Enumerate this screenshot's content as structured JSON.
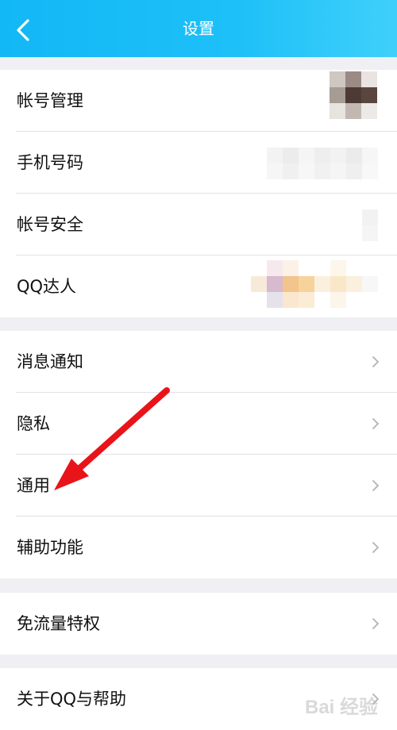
{
  "header": {
    "title": "设置"
  },
  "account_group": [
    {
      "label": "帐号管理"
    },
    {
      "label": "手机号码"
    },
    {
      "label": "帐号安全"
    },
    {
      "label": "QQ达人"
    }
  ],
  "settings_group": [
    {
      "label": "消息通知"
    },
    {
      "label": "隐私"
    },
    {
      "label": "通用"
    },
    {
      "label": "辅助功能"
    }
  ],
  "privilege_group": [
    {
      "label": "免流量特权"
    }
  ],
  "about_group": [
    {
      "label": "关于QQ与帮助"
    }
  ],
  "watermark": {
    "text": "Bai 经验"
  },
  "colors": {
    "header_gradient_start": "#12b7f5",
    "header_gradient_end": "#3fd0fa",
    "annotation_arrow": "#e8141a"
  }
}
